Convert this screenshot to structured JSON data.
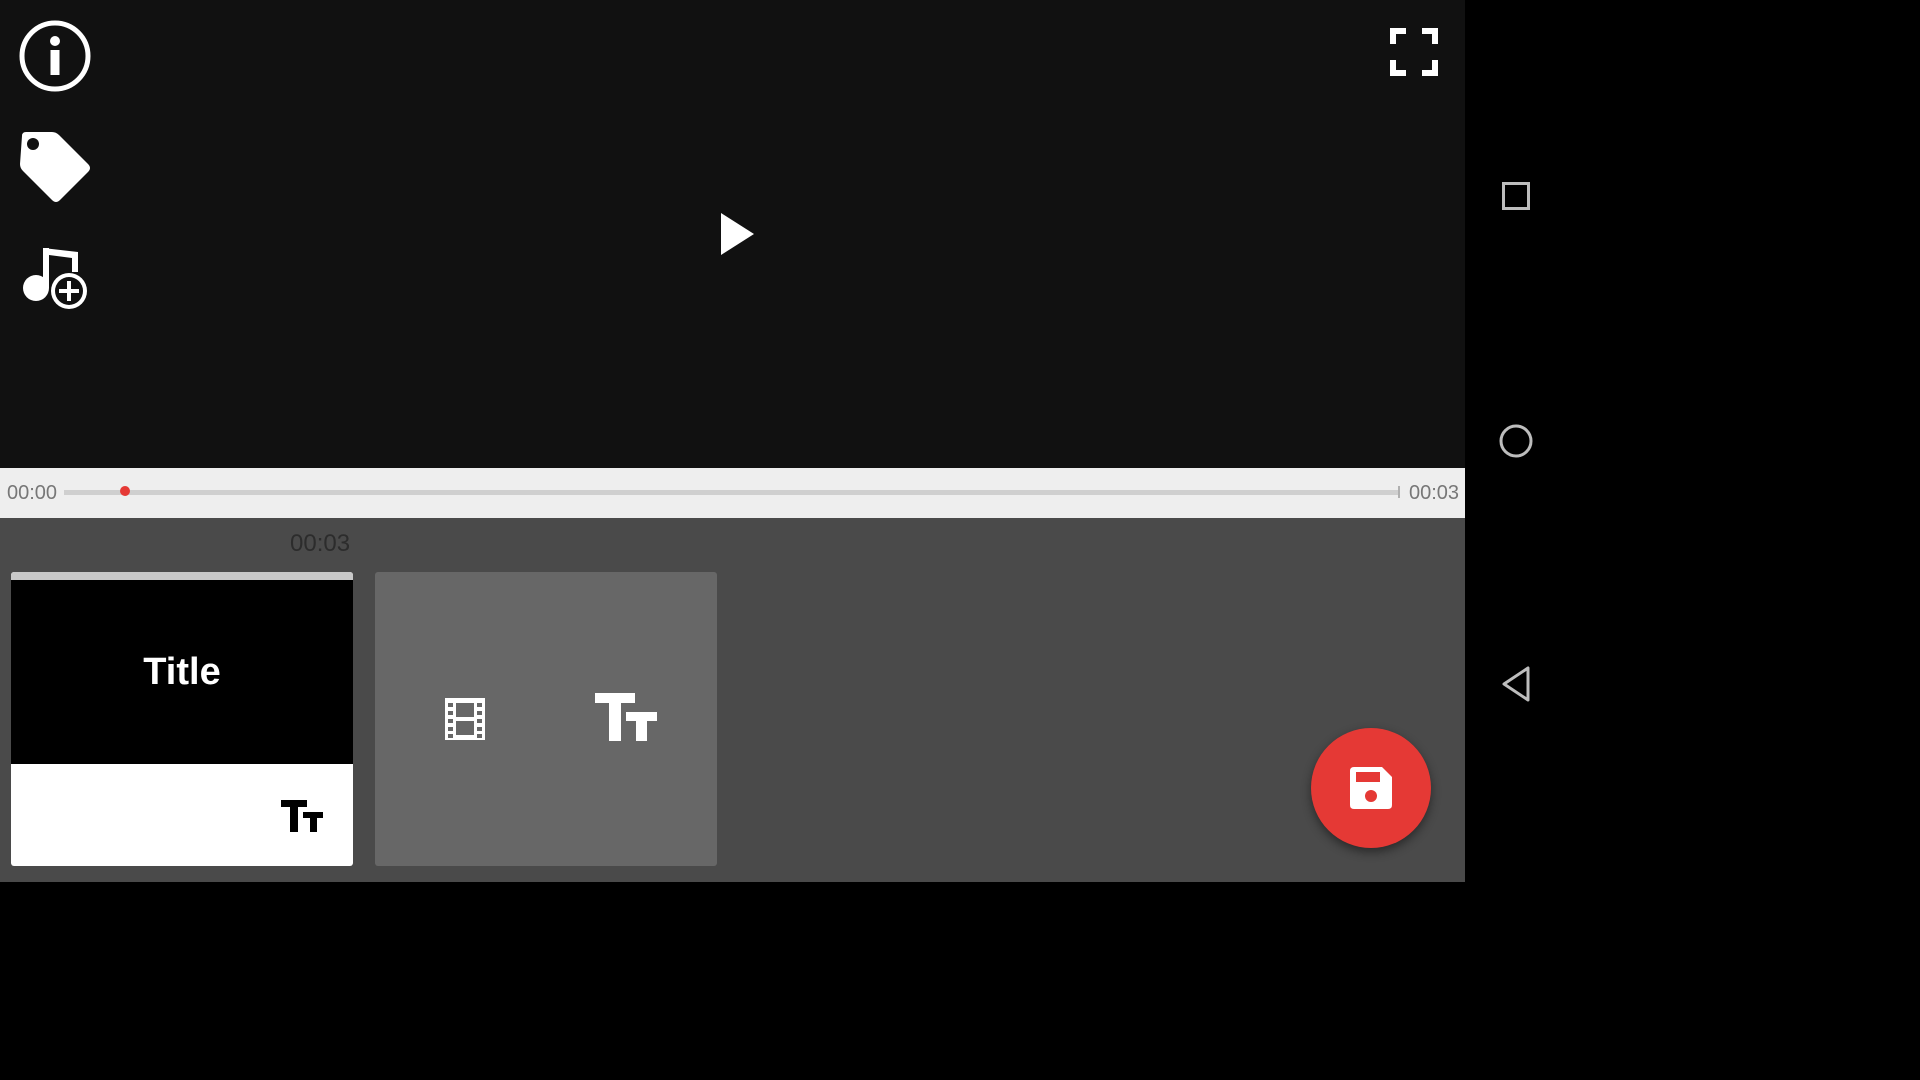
{
  "player": {
    "current_time": "00:00",
    "total_time": "00:03",
    "progress_fraction": 0.046
  },
  "timeline": {
    "clip_duration": "00:03",
    "clips": [
      {
        "title": "Title"
      }
    ]
  },
  "icons": {
    "info": "info-icon",
    "tag": "tag-icon",
    "add_music": "music-add-icon",
    "fullscreen": "fullscreen-icon",
    "play": "play-icon",
    "add_media": "film-icon",
    "add_title": "text-format-icon",
    "save": "save-icon",
    "nav_recents": "square-icon",
    "nav_home": "circle-icon",
    "nav_back": "triangle-back-icon"
  },
  "colors": {
    "accent": "#e53935",
    "preview_bg": "#111111",
    "timeline_bg": "#4a4a4a",
    "card_bg": "#676767"
  }
}
